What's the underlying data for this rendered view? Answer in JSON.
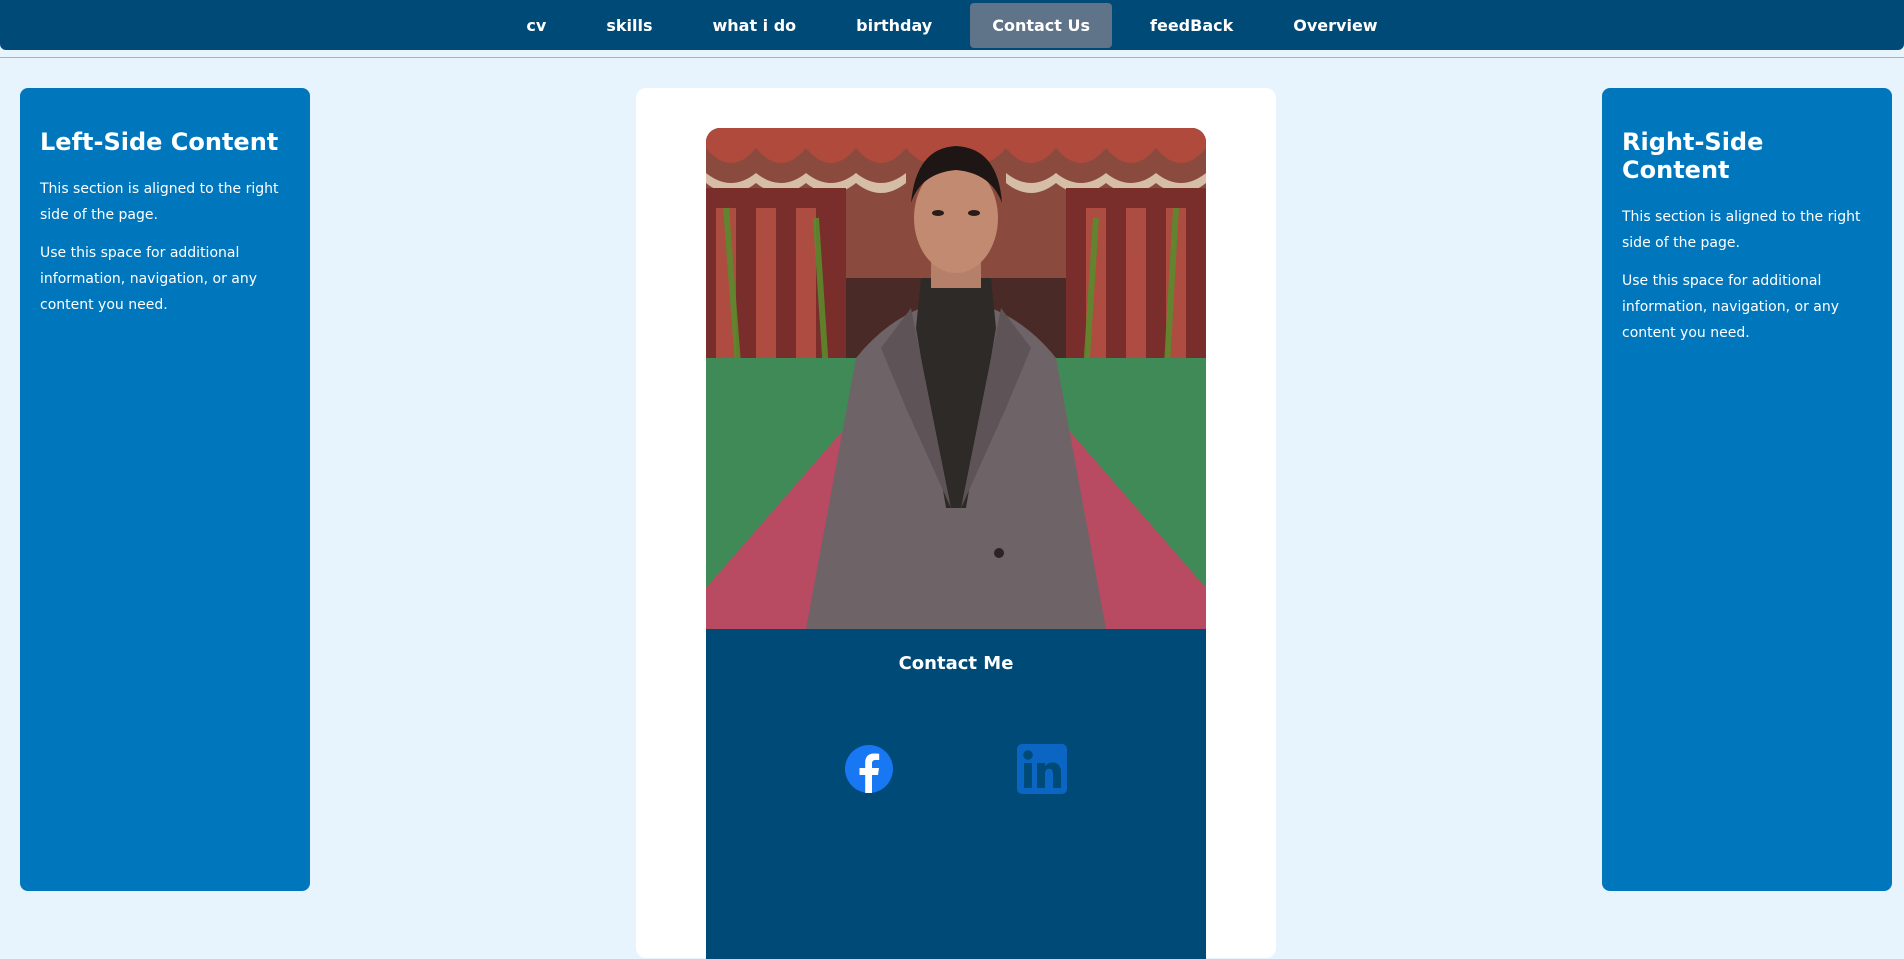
{
  "nav": {
    "items": [
      {
        "label": "cv"
      },
      {
        "label": "skills"
      },
      {
        "label": "what i do"
      },
      {
        "label": "birthday"
      },
      {
        "label": "Contact Us"
      },
      {
        "label": "feedBack"
      },
      {
        "label": "Overview"
      }
    ],
    "active_index": 4
  },
  "left_panel": {
    "title": "Left-Side Content",
    "p1": "This section is aligned to the right side of the page.",
    "p2": "Use this space for additional information, navigation, or any content you need."
  },
  "right_panel": {
    "title": "Right-Side Content",
    "p1": "This section is aligned to the right side of the page.",
    "p2": "Use this space for additional information, navigation, or any content you need."
  },
  "contact": {
    "title": "Contact Me",
    "icons": [
      "facebook-icon",
      "linkedin-icon"
    ]
  },
  "colors": {
    "nav_bg": "#004a78",
    "panel_bg": "#0077bd",
    "page_bg": "#e8f4fd",
    "facebook": "#1877f2",
    "linkedin": "#0a66c2"
  }
}
